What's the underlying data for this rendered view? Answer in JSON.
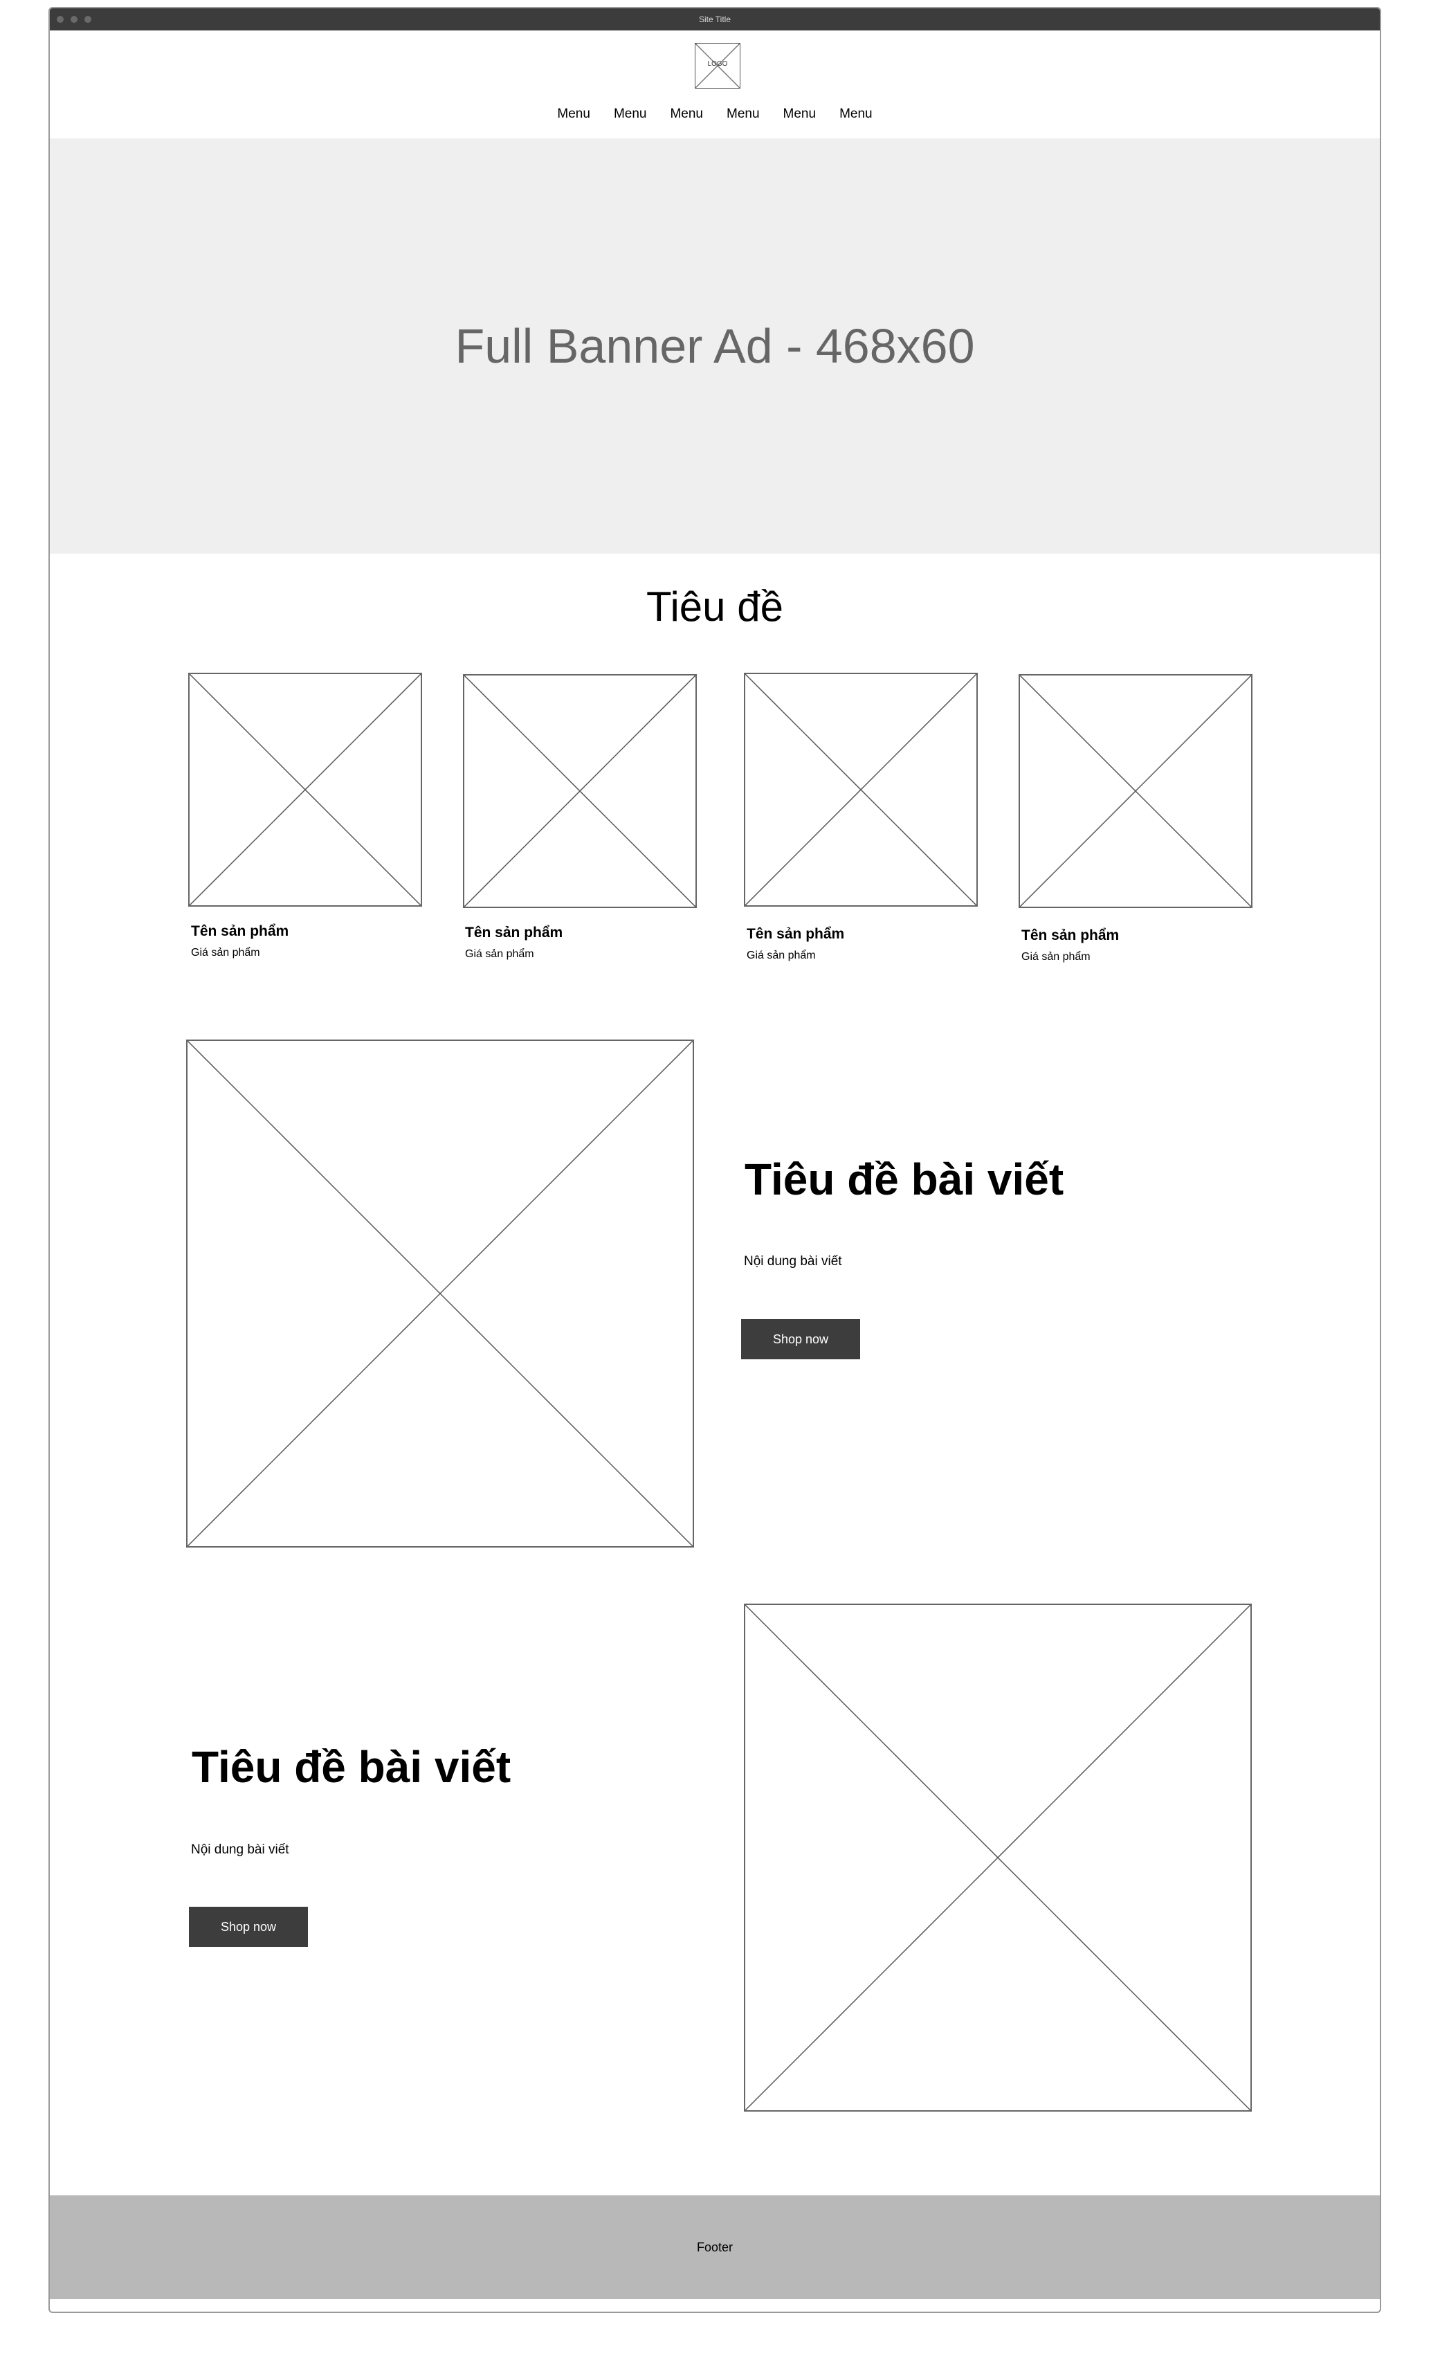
{
  "window": {
    "site_title": "Site Title"
  },
  "header": {
    "logo_text": "LOGO",
    "menu": [
      "Menu",
      "Menu",
      "Menu",
      "Menu",
      "Menu",
      "Menu"
    ]
  },
  "banner": {
    "text": "Full Banner Ad - 468x60"
  },
  "products_section": {
    "title": "Tiêu đề",
    "products": [
      {
        "name": "Tên sản phẩm",
        "price": "Giá sản phẩm"
      },
      {
        "name": "Tên sản phẩm",
        "price": "Giá sản phẩm"
      },
      {
        "name": "Tên sản phẩm",
        "price": "Giá sản phẩm"
      },
      {
        "name": "Tên sản phẩm",
        "price": "Giá sản phẩm"
      }
    ]
  },
  "articles": [
    {
      "title": "Tiêu đề bài viết",
      "body": "Nội dung bài viết",
      "button": "Shop now"
    },
    {
      "title": "Tiêu đề bài viết",
      "body": "Nội dung bài viết",
      "button": "Shop now"
    }
  ],
  "footer": {
    "text": "Footer"
  }
}
